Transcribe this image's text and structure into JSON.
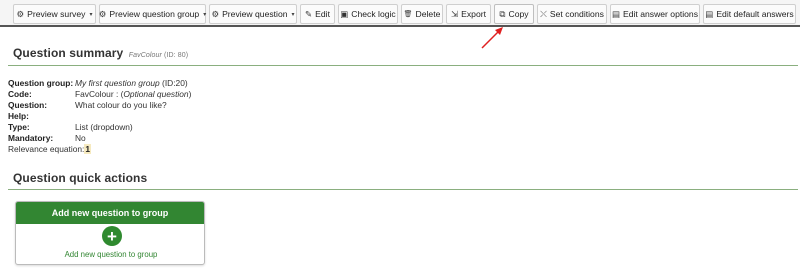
{
  "toolbar": {
    "buttons": [
      {
        "label": "Preview survey",
        "icon": "gear-icon",
        "glyph": "⚙",
        "dropdown": true
      },
      {
        "label": "Preview question group",
        "icon": "gear-icon",
        "glyph": "⚙",
        "dropdown": true
      },
      {
        "label": "Preview question",
        "icon": "gear-icon",
        "glyph": "⚙",
        "dropdown": true
      },
      {
        "label": "Edit",
        "icon": "pencil-icon",
        "glyph": "✎",
        "dropdown": false
      },
      {
        "label": "Check logic",
        "icon": "check-logic-icon",
        "glyph": "▣",
        "dropdown": false
      },
      {
        "label": "Delete",
        "icon": "trash-icon",
        "glyph": "🗑",
        "dropdown": false
      },
      {
        "label": "Export",
        "icon": "export-icon",
        "glyph": "⇲",
        "dropdown": false
      },
      {
        "label": "Copy",
        "icon": "copy-icon",
        "glyph": "⧉",
        "dropdown": false
      },
      {
        "label": "Set conditions",
        "icon": "conditions-icon",
        "glyph": "⤬",
        "dropdown": false
      },
      {
        "label": "Edit answer options",
        "icon": "list-icon",
        "glyph": "▤",
        "dropdown": false
      },
      {
        "label": "Edit default answers",
        "icon": "list-icon",
        "glyph": "▤",
        "dropdown": false
      }
    ],
    "caret": "▾"
  },
  "summary": {
    "title": "Question summary",
    "code_label": "FavColour",
    "id_text": "(ID: 80)",
    "rows": [
      {
        "label": "Question group:",
        "value_italic": "My first question group",
        "value": " (ID:20)"
      },
      {
        "label": "Code:",
        "value": "FavColour : (",
        "value_italic": "Optional question",
        "value_after": ")"
      },
      {
        "label": "Question:",
        "value": "What colour do you like?"
      },
      {
        "label": "Help:",
        "value": ""
      },
      {
        "label": "Type:",
        "value": "List (dropdown)"
      },
      {
        "label": "Mandatory:",
        "value": "No"
      }
    ],
    "relevance_label": "Relevance equation:",
    "relevance_value": "1"
  },
  "quick_actions": {
    "title": "Question quick actions",
    "card_title": "Add new question to group",
    "card_icon": "plus-circle-icon",
    "card_link": "Add new question to group"
  },
  "colors": {
    "accent_green": "#328632",
    "rule_green": "#8aaf7f",
    "annotation_arrow": "#e02020"
  }
}
